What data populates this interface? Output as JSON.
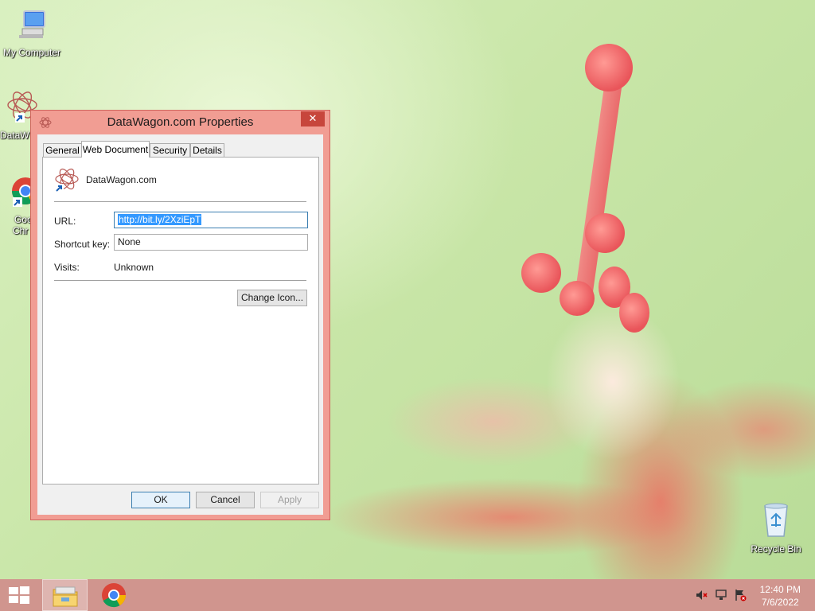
{
  "desktop": {
    "icons": [
      {
        "label": "My Computer",
        "icon": "computer-icon"
      },
      {
        "label": "DataW",
        "icon": "datawagon-shortcut-icon"
      },
      {
        "label": "Goo",
        "label2": "Chr",
        "icon": "chrome-shortcut-icon"
      },
      {
        "label": "Recycle Bin",
        "icon": "recycle-bin-icon"
      }
    ]
  },
  "window": {
    "title": "DataWagon.com Properties",
    "close_label": "✕",
    "tabs": [
      "General",
      "Web Document",
      "Security",
      "Details"
    ],
    "active_tab": "Web Document",
    "header_name": "DataWagon.com",
    "url_label": "URL:",
    "url_value": "http://bit.ly/2XziEpT",
    "shortcut_label": "Shortcut key:",
    "shortcut_value": "None",
    "visits_label": "Visits:",
    "visits_value": "Unknown",
    "change_icon_label": "Change Icon...",
    "ok_label": "OK",
    "cancel_label": "Cancel",
    "apply_label": "Apply"
  },
  "taskbar": {
    "items": [
      "start-button",
      "file-explorer",
      "google-chrome"
    ],
    "clock_time": "12:40 PM",
    "clock_date": "7/6/2022"
  },
  "colors": {
    "window_frame": "#f19d93",
    "taskbar": "#d0958e",
    "selection": "#3399ff"
  }
}
